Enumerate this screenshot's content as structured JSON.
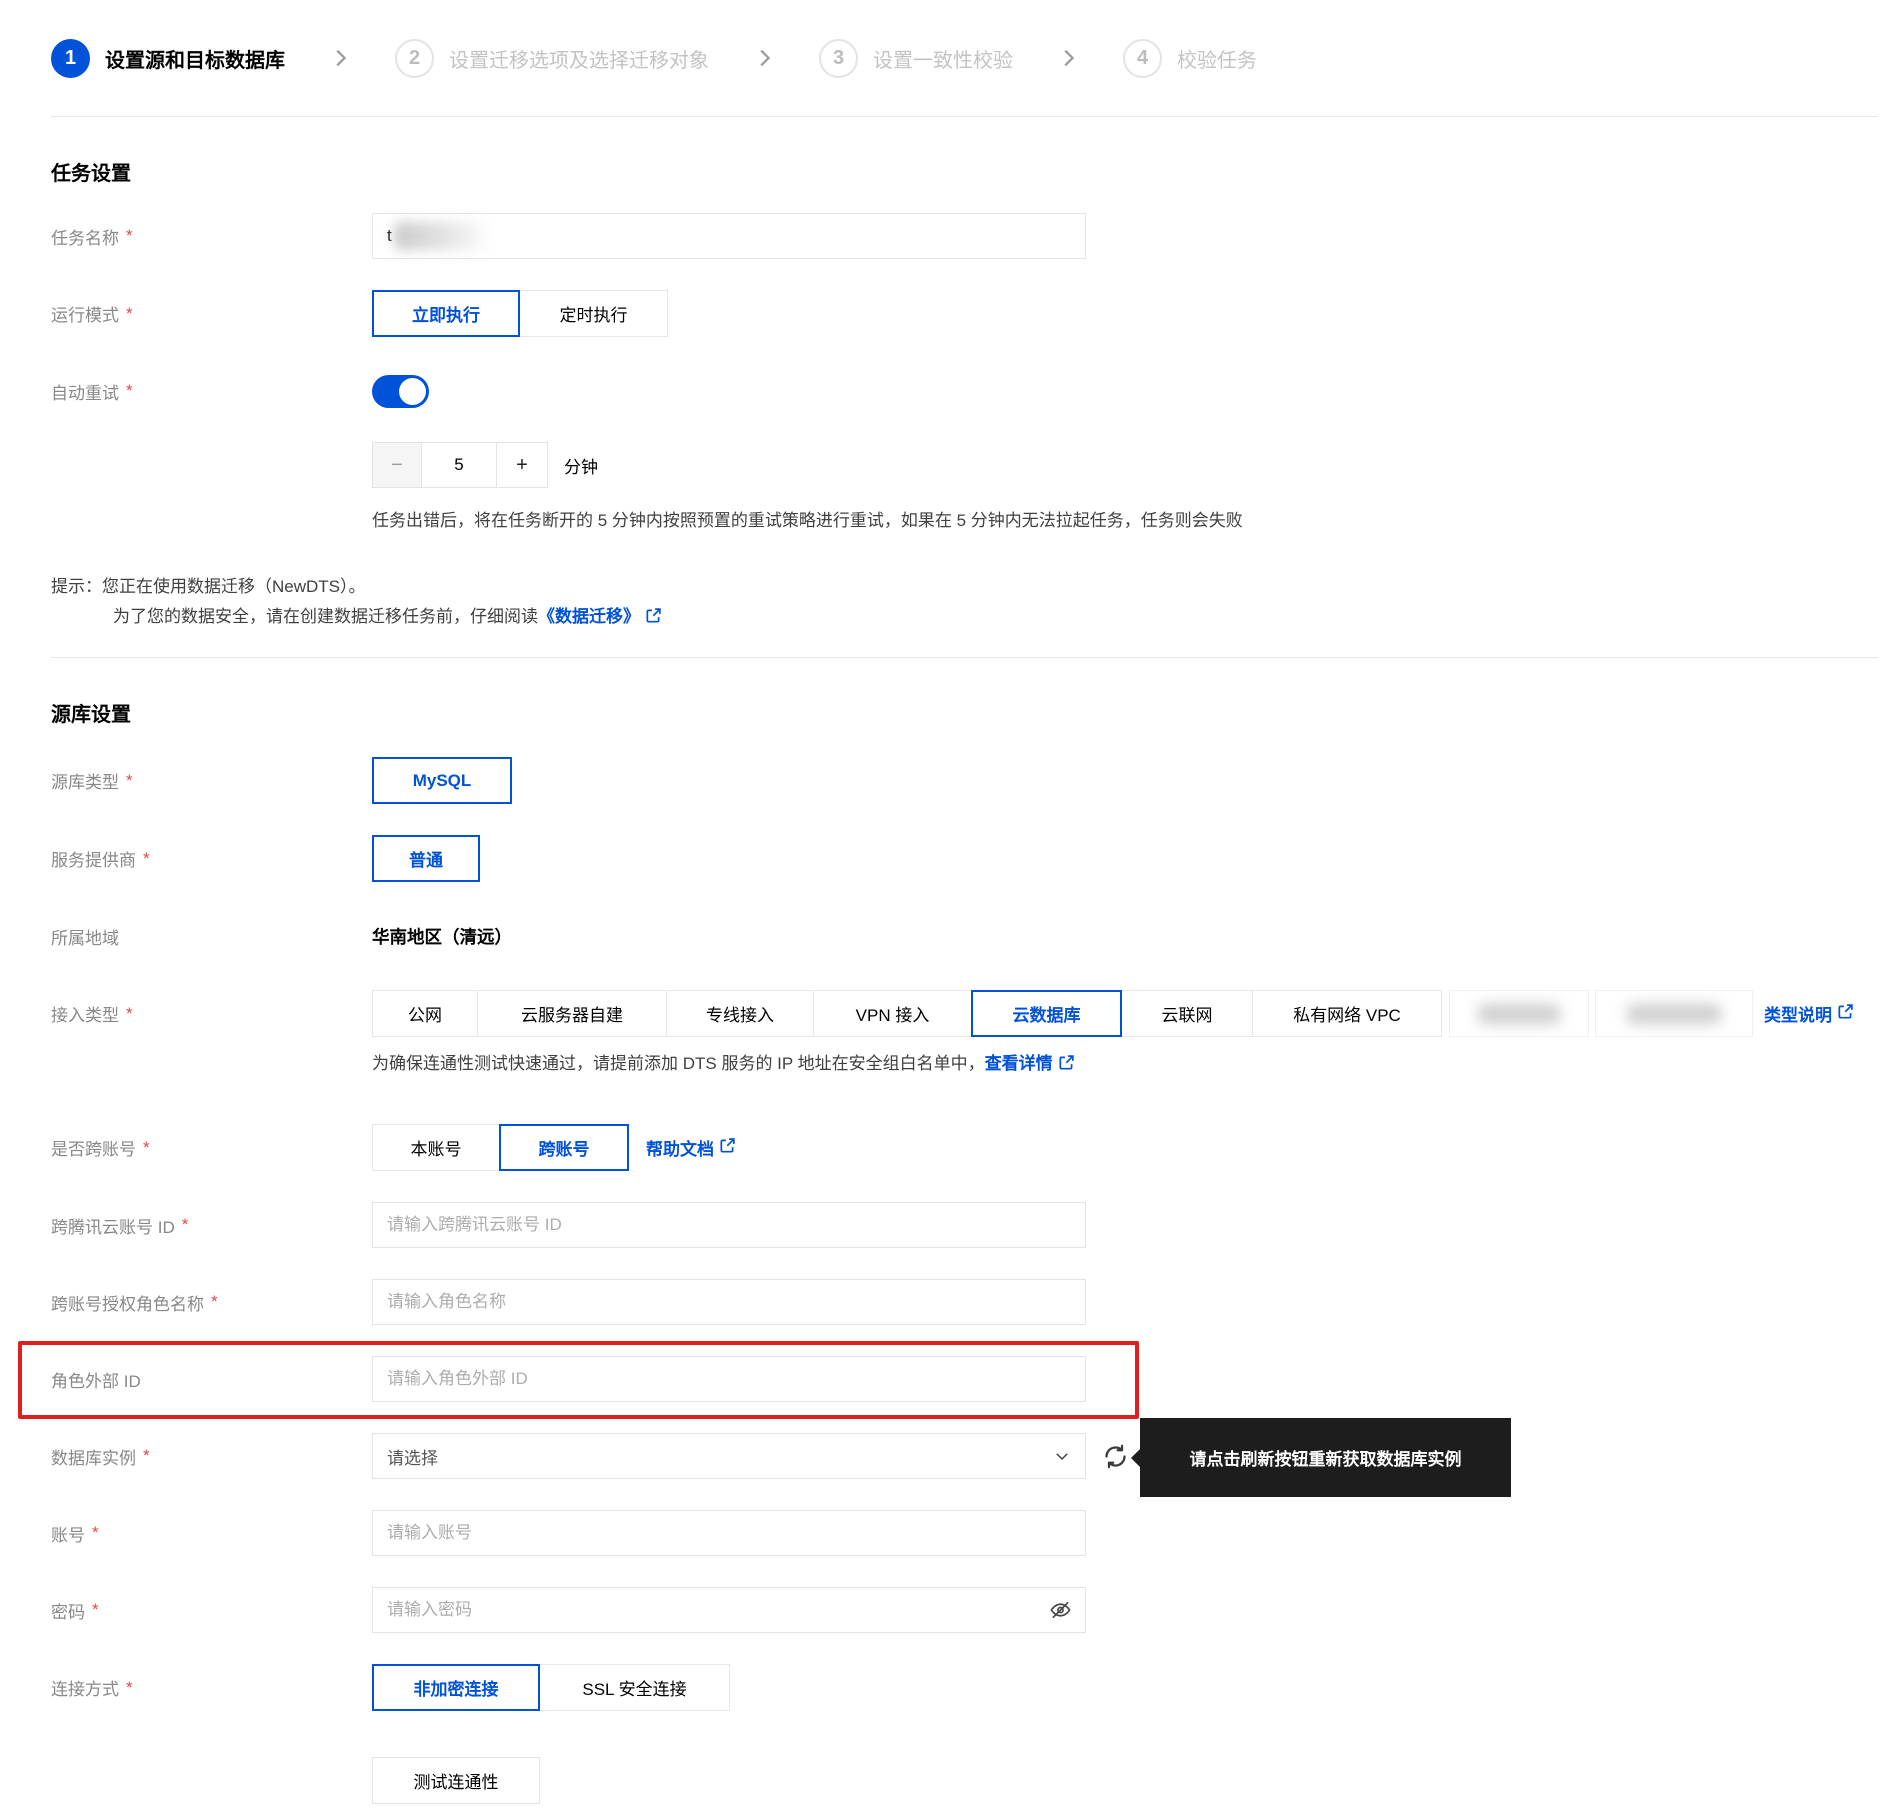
{
  "shared": {
    "required_mark": "*"
  },
  "steps": {
    "items": [
      {
        "number": "1",
        "label": "设置源和目标数据库",
        "state": "active"
      },
      {
        "number": "2",
        "label": "设置迁移选项及选择迁移对象",
        "state": "inactive"
      },
      {
        "number": "3",
        "label": "设置一致性校验",
        "state": "inactive"
      },
      {
        "number": "4",
        "label": "校验任务",
        "state": "inactive"
      }
    ]
  },
  "task_settings": {
    "title": "任务设置",
    "task_name": {
      "label": "任务名称",
      "value": "t"
    },
    "run_mode": {
      "label": "运行模式",
      "options": [
        "立即执行",
        "定时执行"
      ],
      "selected": "立即执行"
    },
    "auto_retry": {
      "label": "自动重试",
      "enabled": true,
      "minus": "−",
      "value": "5",
      "plus": "+",
      "unit": "分钟",
      "description": "任务出错后，将在任务断开的 5 分钟内按照预置的重试策略进行重试，如果在 5 分钟内无法拉起任务，任务则会失败"
    },
    "tip_line1": "提示：您正在使用数据迁移（NewDTS）。",
    "tip_line2_prefix": "为了您的数据安全，请在创建数据迁移任务前，仔细阅读",
    "tip_link": "《数据迁移》"
  },
  "source_settings": {
    "title": "源库设置",
    "db_type": {
      "label": "源库类型",
      "selected": "MySQL"
    },
    "provider": {
      "label": "服务提供商",
      "selected": "普通"
    },
    "region": {
      "label": "所属地域",
      "value": "华南地区（清远）"
    },
    "access_type": {
      "label": "接入类型",
      "options": [
        "公网",
        "云服务器自建",
        "专线接入",
        "VPN 接入",
        "云数据库",
        "云联网",
        "私有网络 VPC"
      ],
      "selected": "云数据库",
      "type_help_link": "类型说明",
      "note_prefix": "为确保连通性测试快速通过，请提前添加 DTS 服务的 IP 地址在安全组白名单中，",
      "note_link": "查看详情"
    },
    "cross_account": {
      "label": "是否跨账号",
      "options": [
        "本账号",
        "跨账号"
      ],
      "selected": "跨账号",
      "help_link": "帮助文档"
    },
    "account_id": {
      "label": "跨腾讯云账号 ID",
      "placeholder": "请输入跨腾讯云账号 ID"
    },
    "role_name": {
      "label": "跨账号授权角色名称",
      "placeholder": "请输入角色名称"
    },
    "external_id": {
      "label": "角色外部 ID",
      "placeholder": "请输入角色外部 ID"
    },
    "instance": {
      "label": "数据库实例",
      "placeholder": "请选择",
      "tooltip": "请点击刷新按钮重新获取数据库实例"
    },
    "account": {
      "label": "账号",
      "placeholder": "请输入账号"
    },
    "password": {
      "label": "密码",
      "placeholder": "请输入密码"
    },
    "connect_mode": {
      "label": "连接方式",
      "options": [
        "非加密连接",
        "SSL 安全连接"
      ],
      "selected": "非加密连接"
    },
    "test_button": "测试连通性"
  },
  "colors": {
    "primary": "#0052d9",
    "annotation_red": "#e01e1e",
    "tooltip_bg": "#1d1d1d",
    "required_red": "#e54545"
  }
}
